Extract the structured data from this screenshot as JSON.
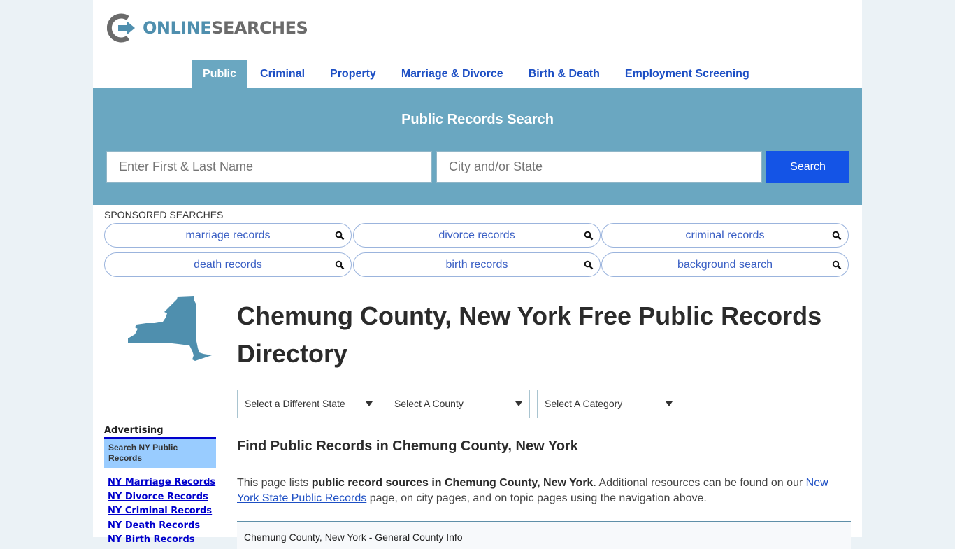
{
  "brand": {
    "online": "ONLINE",
    "searches": "SEARCHES"
  },
  "nav": [
    {
      "label": "Public",
      "active": true
    },
    {
      "label": "Criminal"
    },
    {
      "label": "Property"
    },
    {
      "label": "Marriage & Divorce"
    },
    {
      "label": "Birth & Death"
    },
    {
      "label": "Employment Screening"
    }
  ],
  "search": {
    "title": "Public Records Search",
    "name_placeholder": "Enter First & Last Name",
    "location_placeholder": "City and/or State",
    "button_label": "Search"
  },
  "sponsored": {
    "label": "SPONSORED SEARCHES",
    "items": [
      "marriage records",
      "divorce records",
      "criminal records",
      "death records",
      "birth records",
      "background search"
    ]
  },
  "page": {
    "title": "Chemung County, New York Free Public Records Directory",
    "selects": [
      "Select a Different State",
      "Select A County",
      "Select A Category"
    ],
    "subheading": "Find Public Records in Chemung County, New York",
    "intro": {
      "prefix": "This page lists ",
      "bold": "public record sources in Chemung County, New York",
      "middle": ". Additional resources can be found on our ",
      "link": "New York State Public Records",
      "suffix": " page, on city pages, and on topic pages using the navigation above."
    },
    "info_header": "Chemung County, New York - General County Info"
  },
  "sidebar": {
    "advertising_label": "Advertising",
    "box_title": "Search NY Public Records",
    "links": [
      "NY Marriage Records",
      "NY Divorce Records",
      "NY Criminal Records",
      "NY Death Records",
      "NY Birth Records"
    ]
  },
  "colors": {
    "accent": "#6aa7c1",
    "button": "#1454e6",
    "link": "#1d4fc4",
    "background": "#ebf2f6"
  }
}
